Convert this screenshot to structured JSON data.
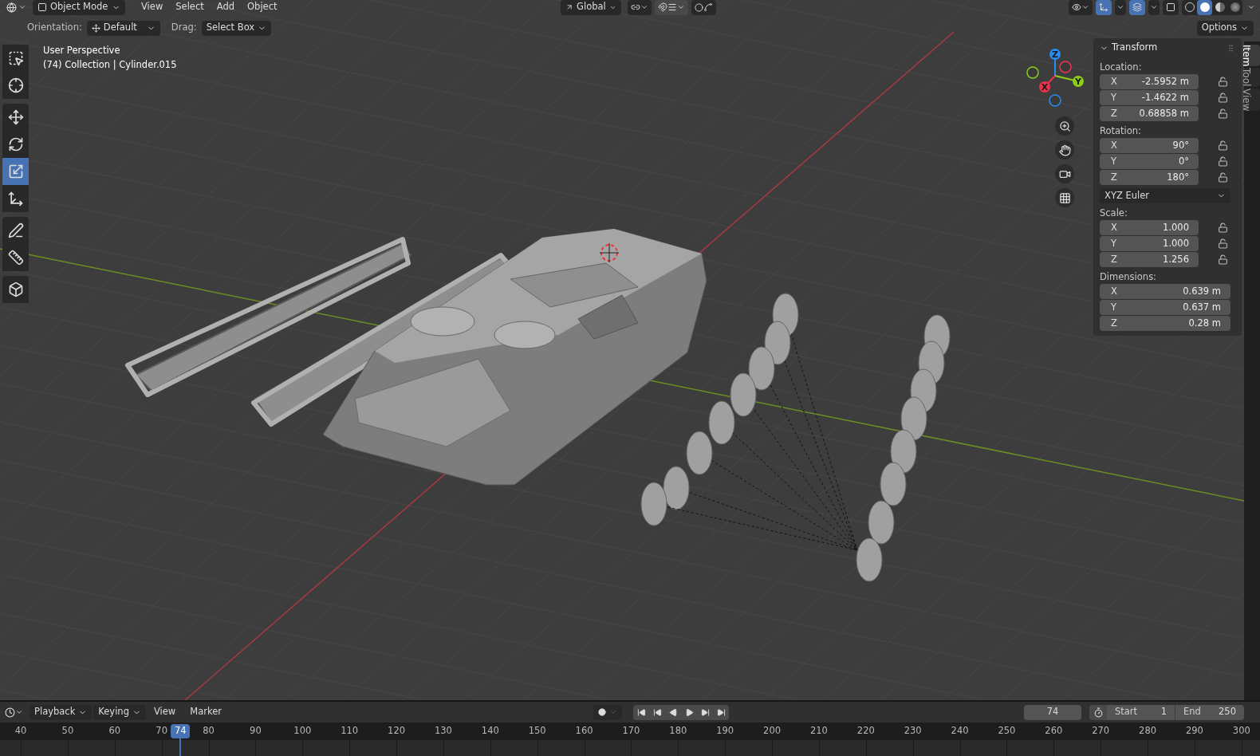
{
  "header": {
    "mode": "Object Mode",
    "menus": [
      "View",
      "Select",
      "Add",
      "Object"
    ],
    "orientation": "Global",
    "shading_modes": [
      {
        "kind": "wireframe",
        "selected": false
      },
      {
        "kind": "solid",
        "selected": true
      },
      {
        "kind": "material",
        "selected": false
      },
      {
        "kind": "rendered",
        "selected": false
      }
    ],
    "options": "Options"
  },
  "tool_settings": {
    "orientation_label": "Orientation:",
    "orientation": "Default",
    "drag_label": "Drag:",
    "drag": "Select Box"
  },
  "toolbar": [
    {
      "kind": "select_box",
      "selected": false
    },
    {
      "kind": "cursor",
      "selected": false
    },
    {
      "kind": "move",
      "selected": false
    },
    {
      "kind": "rotate",
      "selected": false
    },
    {
      "kind": "scale",
      "selected": true
    },
    {
      "kind": "transform",
      "selected": false
    },
    {
      "kind": "annotate",
      "selected": false
    },
    {
      "kind": "measure",
      "selected": false
    },
    {
      "kind": "add_cube",
      "selected": false
    }
  ],
  "viewport": {
    "title": "User Perspective",
    "subtitle": "(74) Collection | Cylinder.015"
  },
  "gizmo_axes": [
    {
      "label": "Z",
      "color": "#2b8cf0"
    },
    {
      "label": "Y",
      "color": "#8bcf1a"
    },
    {
      "label": "X",
      "color": "#f0324f"
    }
  ],
  "sidebar": {
    "panel": "Transform",
    "expanded": true,
    "sections": [
      {
        "label": "Location:",
        "rows": [
          {
            "axis": "X",
            "value": "-2.5952 m",
            "locked": false
          },
          {
            "axis": "Y",
            "value": "-1.4622 m",
            "locked": false
          },
          {
            "axis": "Z",
            "value": "0.68858 m",
            "locked": false
          }
        ]
      },
      {
        "label": "Rotation:",
        "rows": [
          {
            "axis": "X",
            "value": "90°",
            "locked": false
          },
          {
            "axis": "Y",
            "value": "0°",
            "locked": false
          },
          {
            "axis": "Z",
            "value": "180°",
            "locked": false
          }
        ],
        "mode": "XYZ Euler"
      },
      {
        "label": "Scale:",
        "rows": [
          {
            "axis": "X",
            "value": "1.000",
            "locked": false
          },
          {
            "axis": "Y",
            "value": "1.000",
            "locked": false
          },
          {
            "axis": "Z",
            "value": "1.256",
            "locked": false
          }
        ]
      },
      {
        "label": "Dimensions:",
        "rows": [
          {
            "axis": "X",
            "value": "0.639 m"
          },
          {
            "axis": "Y",
            "value": "0.637 m"
          },
          {
            "axis": "Z",
            "value": "0.28 m"
          }
        ]
      }
    ],
    "tabs": [
      {
        "label": "Item",
        "selected": true
      },
      {
        "label": "Tool",
        "selected": false
      },
      {
        "label": "View",
        "selected": false
      }
    ]
  },
  "timeline": {
    "menus": [
      {
        "label": "Playback",
        "dropdown": true
      },
      {
        "label": "Keying",
        "dropdown": true
      },
      {
        "label": "View",
        "dropdown": false
      },
      {
        "label": "Marker",
        "dropdown": false
      }
    ],
    "current_frame": "74",
    "start_label": "Start",
    "start": "1",
    "end_label": "End",
    "end": "250",
    "ticks": [
      "40",
      "50",
      "60",
      "70",
      "80",
      "90",
      "100",
      "110",
      "120",
      "130",
      "140",
      "150",
      "160",
      "170",
      "180",
      "190",
      "200",
      "210",
      "220",
      "230",
      "240",
      "250",
      "260",
      "270",
      "280",
      "290",
      "300"
    ],
    "playhead": {
      "label": "74",
      "level": 0.1308
    }
  }
}
